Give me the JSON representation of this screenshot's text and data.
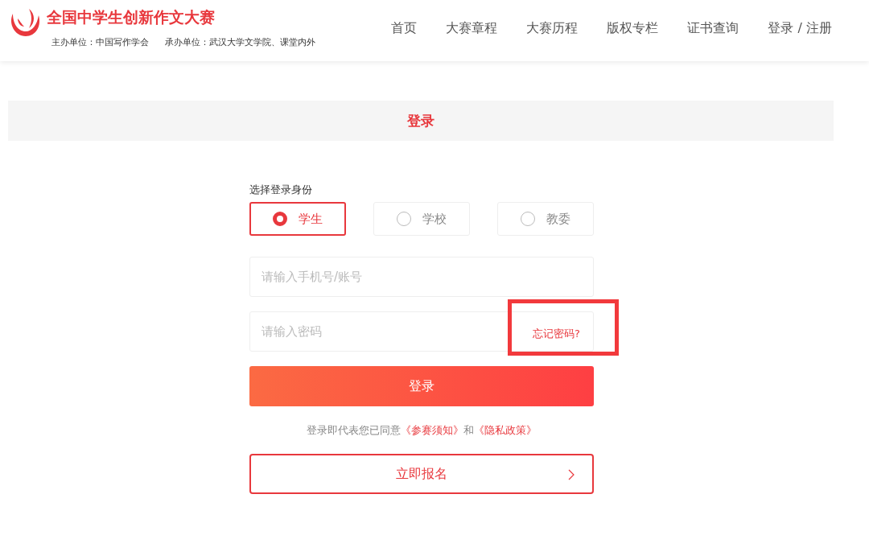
{
  "header": {
    "title": "全国中学生创新作文大赛",
    "organizer": "主办单位：中国写作学会",
    "co_organizer": "承办单位：武汉大学文学院、课堂内外",
    "nav": [
      {
        "label": "首页",
        "selected": false
      },
      {
        "label": "大赛章程",
        "selected": false
      },
      {
        "label": "大赛历程",
        "selected": false
      },
      {
        "label": "版权专栏",
        "selected": false
      },
      {
        "label": "证书查询",
        "selected": false
      },
      {
        "label": "登录 / 注册",
        "selected": false
      }
    ]
  },
  "page_title": "登录",
  "form": {
    "identity_label": "选择登录身份",
    "identities": [
      {
        "label": "学生",
        "selected": true
      },
      {
        "label": "学校",
        "selected": false
      },
      {
        "label": "教委",
        "selected": false
      }
    ],
    "account_field": {
      "placeholder": "请输入手机号/账号"
    },
    "password_field": {
      "placeholder": "请输入密码"
    },
    "forgot_password": {
      "label": "忘记密码?",
      "highlighted": true
    },
    "login_button": "登录",
    "terms": {
      "prefix": "登录即代表您已同意",
      "link_1": "《参赛须知》",
      "middle": "和",
      "link_2": "《隐私政策》"
    },
    "register_button": "立即报名"
  }
}
